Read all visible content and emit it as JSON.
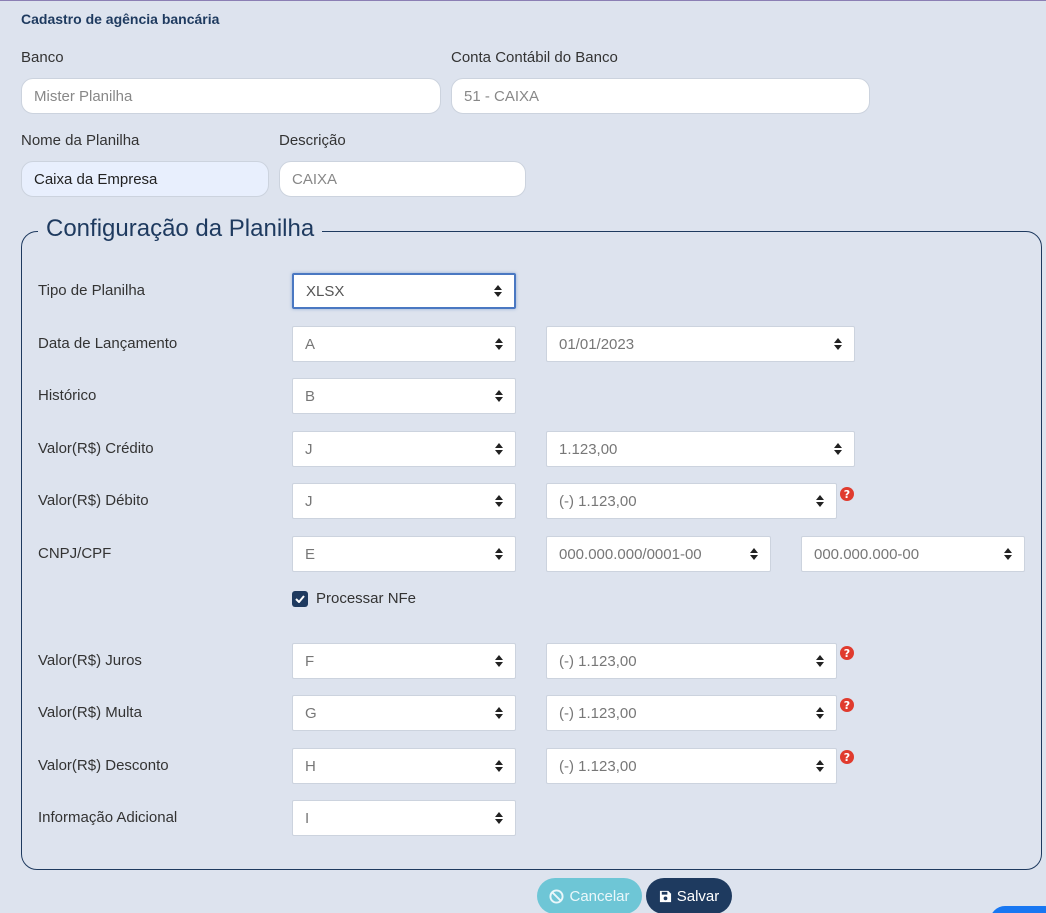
{
  "title": "Cadastro de agência bancária",
  "fields": {
    "banco": {
      "label": "Banco",
      "placeholder": "Mister Planilha"
    },
    "conta": {
      "label": "Conta Contábil do Banco",
      "placeholder": "51 - CAIXA"
    },
    "nome": {
      "label": "Nome da Planilha",
      "value": "Caixa da Empresa"
    },
    "descricao": {
      "label": "Descrição",
      "placeholder": "CAIXA"
    }
  },
  "config": {
    "legend": "Configuração da Planilha",
    "tipo": {
      "label": "Tipo de Planilha",
      "value": "XLSX"
    },
    "data": {
      "label": "Data de Lançamento",
      "col": "A",
      "format": "01/01/2023"
    },
    "historico": {
      "label": "Histórico",
      "col": "B"
    },
    "credito": {
      "label": "Valor(R$) Crédito",
      "col": "J",
      "format": "1.123,00"
    },
    "debito": {
      "label": "Valor(R$) Débito",
      "col": "J",
      "format": "(-) 1.123,00"
    },
    "cnpj": {
      "label": "CNPJ/CPF",
      "col": "E",
      "format_cnpj": "000.000.000/0001-00",
      "format_cpf": "000.000.000-00"
    },
    "nfe": {
      "label": "Processar NFe",
      "checked": true
    },
    "juros": {
      "label": "Valor(R$) Juros",
      "col": "F",
      "format": "(-) 1.123,00"
    },
    "multa": {
      "label": "Valor(R$) Multa",
      "col": "G",
      "format": "(-) 1.123,00"
    },
    "desconto": {
      "label": "Valor(R$) Desconto",
      "col": "H",
      "format": "(-) 1.123,00"
    },
    "info": {
      "label": "Informação Adicional",
      "col": "I"
    },
    "help_glyph": "?"
  },
  "buttons": {
    "cancel": "Cancelar",
    "save": "Salvar"
  },
  "icons": {
    "cancel": "ban-icon",
    "save": "floppy-disk-icon",
    "help": "question-circle-icon",
    "select": "sort-caret-icon"
  },
  "colors": {
    "primary": "#1e3a5f",
    "cancel": "#6ec6d6",
    "help": "#e03b2e",
    "background": "#dde3ee"
  }
}
